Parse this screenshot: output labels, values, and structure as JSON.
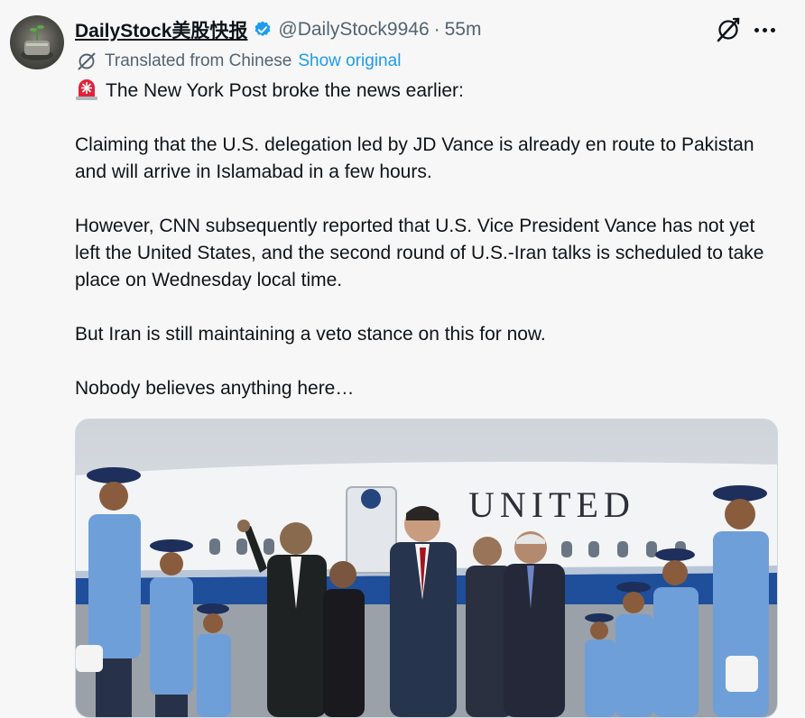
{
  "author": {
    "display_name": "DailyStock美股快报",
    "handle": "@DailyStock9946",
    "separator": "·",
    "time": "55m",
    "verified": true,
    "avatar_icon": "avatar-image"
  },
  "translation": {
    "label": "Translated from Chinese",
    "show_original": "Show original"
  },
  "post": {
    "lines": [
      "The New York Post broke the news earlier:",
      "Claiming that the U.S. delegation led by JD Vance is already en route to Pakistan and will arrive in Islamabad in a few hours.",
      "However, CNN subsequently reported that U.S. Vice President Vance has not yet left the United States, and the second round of U.S.-Iran talks is scheduled to take place on Wednesday local time.",
      "But Iran is still maintaining a veto stance on this for now.",
      "Nobody believes anything here…"
    ],
    "lead_icon": "siren-icon"
  },
  "media": {
    "aircraft_lettering": "UNITED"
  },
  "colors": {
    "accent": "#1d9bf0",
    "text": "#0f1419",
    "secondary": "#536471",
    "background": "#f7f7f7"
  }
}
